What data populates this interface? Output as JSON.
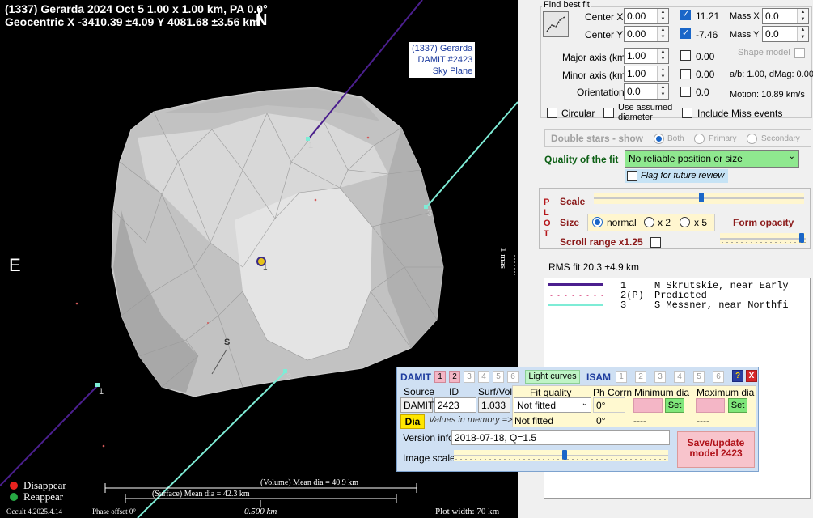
{
  "plot": {
    "header_line1": "(1337) Gerarda  2024 Oct 5   1.00 x 1.00 km,  PA 0.0°",
    "header_line2": "Geocentric  X  -3410.39 ±4.09  Y 4081.68 ±3.56 km",
    "north_label": "N",
    "east_label": "E",
    "damit_label": [
      "(1337) Gerarda",
      "DAMIT #2423",
      "Sky Plane"
    ],
    "chord_labels": [
      "1",
      "3",
      "1",
      "3"
    ],
    "s_label": "S",
    "center_label": "1",
    "scale_label": "1 mas",
    "legend_disappear": "Disappear",
    "legend_reappear": "Reappear",
    "volume_dia": "(Volume) Mean dia = 40.9 km",
    "surface_dia": "(Surface) Mean dia = 42.3 km",
    "scale_bar": "0.500 km",
    "version": "Occult 4.2025.4.14",
    "phase_offset": "Phase offset 0°",
    "plot_width": "Plot width: 70 km",
    "colors": {
      "chord1": "#4b1f8e",
      "chord3": "#7eecd6",
      "disappear": "#e8231f",
      "reappear": "#27a844"
    }
  },
  "panel": {
    "find_best_fit": "Find best fit",
    "center_x_label": "Center X",
    "center_x_value": "0.00",
    "center_y_label": "Center Y",
    "center_y_value": "0.00",
    "center_x_fit": "11.21",
    "center_y_fit": "-7.46",
    "mass_x_label": "Mass X",
    "mass_x_value": "0.0",
    "mass_y_label": "Mass Y",
    "mass_y_value": "0.0",
    "major_label": "Major axis (km)",
    "major_value": "1.00",
    "major_fit": "0.00",
    "minor_label": "Minor axis (km)",
    "minor_value": "1.00",
    "minor_fit": "0.00",
    "orient_label": "Orientation",
    "orient_value": "0.0",
    "orient_fit": "0.0",
    "shape_model": "Shape model",
    "ab_text": "a/b: 1.00, dMag: 0.00",
    "motion_text": "Motion: 10.89 km/s",
    "circular": "Circular",
    "assumed_dia": [
      "Use assumed",
      "diameter"
    ],
    "include_miss": "Include Miss events",
    "double_stars": "Double stars - show",
    "both": "Both",
    "primary": "Primary",
    "secondary": "Secondary",
    "quality_label": "Quality of the fit",
    "quality_value": "No reliable position or size",
    "flag_review": "Flag for future review",
    "plot_letters": [
      "P",
      "L",
      "O",
      "T"
    ],
    "scale_label": "Scale",
    "size_label": "Size",
    "size_normal": "normal",
    "size_x2": "x 2",
    "size_x5": "x 5",
    "form_opacity": "Form opacity",
    "scroll_range": "Scroll range x1.25",
    "rms_fit": "RMS fit 20.3 ±4.9 km",
    "chords": [
      {
        "num": "1",
        "name": "M Skrutskie, near Early"
      },
      {
        "num": "2(P)",
        "name": "Predicted"
      },
      {
        "num": "3",
        "name": "S Messner, near Northfi"
      }
    ],
    "chord_colors": [
      "#4b1f8e",
      "#e06c9a",
      "#7eecd6"
    ]
  },
  "damit": {
    "title": "DAMIT",
    "model_buttons": [
      "1",
      "2",
      "3",
      "4",
      "5",
      "6"
    ],
    "light_curves": "Light curves",
    "isam": "ISAM",
    "isam_buttons": [
      "1",
      "2",
      "3",
      "4",
      "5",
      "6"
    ],
    "help": "?",
    "close": "X",
    "source_label": "Source",
    "id_label": "ID",
    "surfvol_label": "Surf/Vol",
    "source_value": "DAMIT",
    "id_value": "2423",
    "surfvol_value": "1.033",
    "fit_quality_label": "Fit quality",
    "ph_corrn_label": "Ph Corrn",
    "min_dia_label": "Minimum dia",
    "max_dia_label": "Maximum dia",
    "fit_quality_value": "Not fitted",
    "ph_corrn_value": "0°",
    "set": "Set",
    "dia_button": "Dia",
    "values_memory": "Values in memory =>",
    "mem_fit": "Not fitted",
    "mem_ph": "0°",
    "mem_min": "----",
    "mem_max": "----",
    "version_label": "Version info",
    "version_value": "2018-07-18, Q=1.5",
    "image_scale_label": "Image scale",
    "save_button": "Save/update model 2423"
  }
}
